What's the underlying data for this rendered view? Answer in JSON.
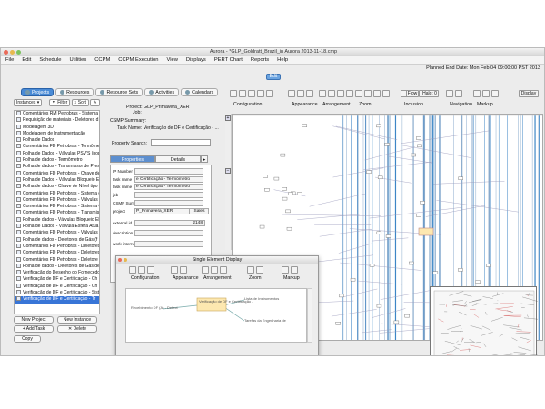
{
  "window": {
    "title": "Aurora - *GLP_Goldratt_Brazil_in Aurora 2013-11-18.cmp"
  },
  "menu": [
    "File",
    "Edit",
    "Schedule",
    "Utilities",
    "CCPM",
    "CCPM Execution",
    "View",
    "Displays",
    "PERT Chart",
    "Reports",
    "Help"
  ],
  "header": {
    "planned_end": "Planned End Date: Mon Feb 04 09:00:00 PST 2013",
    "edit_label": "Edit"
  },
  "left_tabs": [
    "Projects",
    "Resources",
    "Resource Sets",
    "Activities",
    "Calendars"
  ],
  "left_toolbar": {
    "instances": "Instances",
    "filter": "Filter",
    "sort": "Sort"
  },
  "tree_items": [
    "Comentários RM Petrobras - Sistema",
    "Requisição de materiais - Deletores d",
    "Modelagem 3D",
    "Modelagem de Instrumentação",
    "Folha de Dados",
    "Comentários FD Petrobras - Termôme",
    "Folha de Dados - Válvulas PSV'S (pop",
    "Folha de dados - Termômetro",
    "Folha de dados - Transmissor de Pres",
    "Comentários FD Petrobras - Chave de",
    "Folha de Dados - Válvulas Bloqueio Ele",
    "Folha de dados - Chave de Nível tipo",
    "Comentários FD Petrobras - Sistema d",
    "Comentários FD Petrobras - Válvulas B",
    "Comentários FD Petrobras - Sistema C",
    "Comentários FD Petrobras - Transmis",
    "Folha de dados - Válvulas Bloqueio El",
    "Folha de Dados - Válvula Esfera Atua",
    "Comentários FD Petrobras - Válvulas",
    "Folha de dados - Deletores de Gás (f",
    "Comentários FD Petrobras - Deletores",
    "Comentários FD Petrobras - Deletores",
    "Comentários FD Petrobras - Deletore",
    "Folha de dados - Deletores de Gás de",
    "Verificação do Desenho do Fornecedo",
    "Verificação de DF e Certificação - Ch",
    "Verificação de DF e Certificação - Ch",
    "Verificação de DF e Certificação - Sist",
    "Verificação de DF e Certificação - Tr"
  ],
  "tree_buttons": {
    "new_project": "New Project",
    "new_instance": "New Instance",
    "add_task": "Add Task",
    "delete": "Delete",
    "copy": "Copy"
  },
  "project_info": {
    "project": "Project: GLP_Primavera_XER",
    "job": "Job:",
    "summary": "CSMP Summary:",
    "task_name": "Task Name: Verificação de DF e Certificação - ..."
  },
  "property_search": "Property Search:",
  "prop_tabs": [
    "Properties",
    "Details"
  ],
  "fields": [
    {
      "label": "IP Number",
      "value": ""
    },
    {
      "label": "task name",
      "value": "e Certificação - Termômetro"
    },
    {
      "label": "task name",
      "value": "e Certificação - Termômetro"
    },
    {
      "label": "job",
      "value": ""
    },
    {
      "label": "CSMP Summary",
      "value": ""
    },
    {
      "label": "project",
      "value": "P_Primavera_XER"
    },
    {
      "label": "external id",
      "value": "2148"
    },
    {
      "label": "description",
      "value": ""
    },
    {
      "label": "work interrupt",
      "value": ""
    }
  ],
  "sales_label": "Sales",
  "toolbar_groups": [
    "Configuration",
    "Appearance",
    "Arrangement",
    "Zoom",
    "Inclusion",
    "Navigation",
    "Markup"
  ],
  "toolbar_extra": {
    "flow": "Flow",
    "halo": "Halo: 0",
    "display": "Display"
  },
  "popup": {
    "title": "Single Element Display",
    "groups": [
      "Configuration",
      "Appearance",
      "Arrangement",
      "Zoom",
      "Markup"
    ],
    "nodes": [
      "Recebimento DF (A) - Detect",
      "Verificação de DF e Certificação -",
      "Lista de Instrumentos",
      "Tarefas da Engenharia de"
    ]
  },
  "colors": {
    "accent": "#3875d7",
    "edit": "#6aa3e0",
    "task_node": "#fde8b0"
  }
}
